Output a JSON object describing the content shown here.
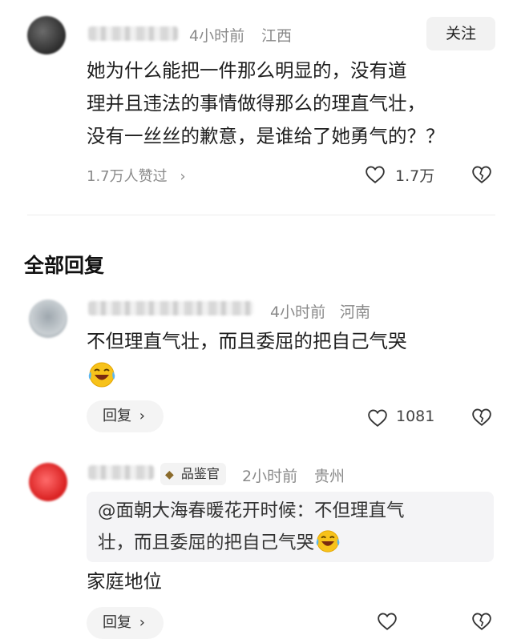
{
  "comment": {
    "time": "4小时前",
    "location": "江西",
    "follow_label": "关注",
    "text_lines": [
      "她为什么能把一件那么明显的，没有道",
      "理并且违法的事情做得那么的理直气壮，",
      "没有一丝丝的歉意，是谁给了她勇气的？？"
    ],
    "likes_summary": "1.7万人赞过",
    "like_count": "1.7万"
  },
  "section_title": "全部回复",
  "replies": [
    {
      "time": "4小时前",
      "location": "河南",
      "text": "不但理直气壮，而且委屈的把自己气哭",
      "emoji": "laughing-crying-emoji",
      "reply_label": "回复",
      "like_count": "1081"
    },
    {
      "badge": "品鉴官",
      "time": "2小时前",
      "location": "贵州",
      "quote_lines": [
        "@面朝大海春暖花开时候：不但理直气",
        "壮，而且委屈的把自己气哭"
      ],
      "text": "家庭地位",
      "reply_label": "回复"
    }
  ],
  "colors": {
    "text": "#1e1e1e",
    "meta": "#8a8a8a",
    "button_bg": "#f2f2f2",
    "emoji_yellow": "#f7c21a"
  }
}
